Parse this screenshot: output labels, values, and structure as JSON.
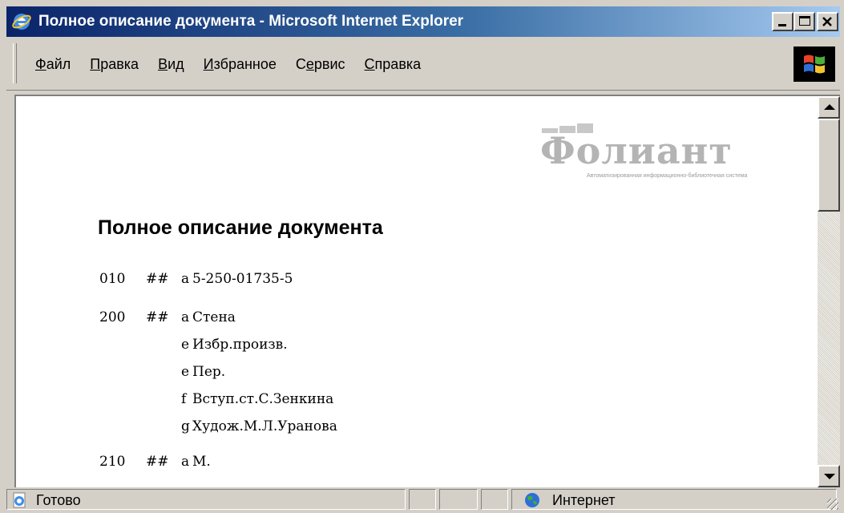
{
  "window": {
    "title": "Полное описание документа - Microsoft Internet Explorer"
  },
  "menu": {
    "items": [
      {
        "accel": "Ф",
        "rest": "айл"
      },
      {
        "accel": "П",
        "rest": "равка"
      },
      {
        "accel": "В",
        "rest": "ид"
      },
      {
        "accel": "И",
        "rest": "збранное"
      },
      {
        "pre": "С",
        "accel": "е",
        "rest": "рвис"
      },
      {
        "accel": "С",
        "rest": "правка"
      }
    ]
  },
  "logo": {
    "word": "Фолиант",
    "subtitle": "Автоматизированная информационно-библиотечная система"
  },
  "document": {
    "title": "Полное описание документа",
    "records": [
      {
        "tag": "010",
        "ind": "##",
        "subfields": [
          {
            "code": "a",
            "value": "5-250-01735-5"
          }
        ]
      },
      {
        "tag": "200",
        "ind": "##",
        "subfields": [
          {
            "code": "a",
            "value": "Стена"
          },
          {
            "code": "e",
            "value": "Избр.произв."
          },
          {
            "code": "e",
            "value": "Пер."
          },
          {
            "code": "f",
            "value": "Вступ.ст.С.Зенкина"
          },
          {
            "code": "g",
            "value": "Худож.М.Л.Уранова"
          }
        ]
      },
      {
        "tag": "210",
        "ind": "##",
        "subfields": [
          {
            "code": "a",
            "value": "М."
          }
        ]
      }
    ]
  },
  "status": {
    "text": "Готово",
    "zone": "Интернет"
  },
  "colors": {
    "titlebar_start": "#0a246a",
    "titlebar_end": "#a6caf0",
    "chrome": "#d4d0c8",
    "logo_gray": "#b4b4b4"
  },
  "icons": {
    "title": "ie-icon",
    "windows_logo": "windows-flag-icon",
    "status": "page-icon",
    "zone": "globe-icon"
  }
}
